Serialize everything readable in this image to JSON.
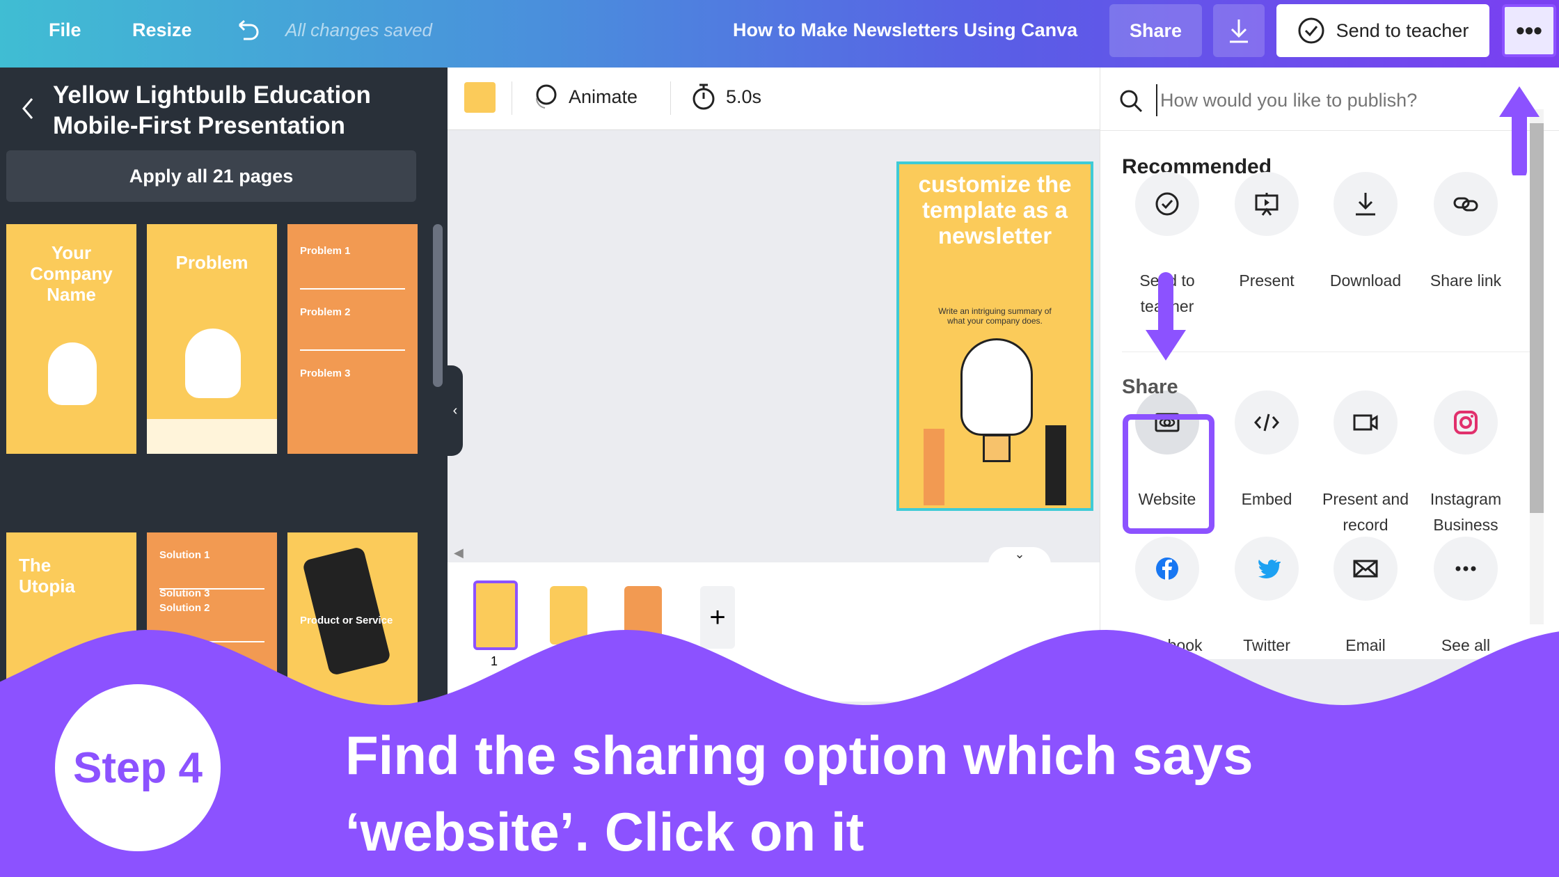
{
  "topbar": {
    "file": "File",
    "resize": "Resize",
    "saved": "All changes saved",
    "title": "How to Make Newsletters Using Canva",
    "share": "Share",
    "send_to_teacher": "Send to teacher"
  },
  "sidebar": {
    "title_line1": "Yellow Lightbulb Education",
    "title_line2": "Mobile-First Presentation",
    "apply": "Apply all 21 pages",
    "thumbs": [
      "Your Company Name",
      "Problem",
      "Problem 1",
      "Problem 2",
      "Problem 3",
      "The Utopia",
      "Solution 1",
      "Solution 2",
      "Solution 3",
      "Product or Service"
    ]
  },
  "toolbar": {
    "color": "#fbcb5a",
    "animate": "Animate",
    "duration": "5.0s"
  },
  "canvas": {
    "heading": "customize the template as a newsletter",
    "summary": "Write an intriguing summary of what your company does.",
    "page_number": "1"
  },
  "panel": {
    "search_placeholder": "How would you like to publish?",
    "recommended": "Recommended",
    "share": "Share",
    "recommended_items": [
      {
        "label": "Send to teacher",
        "icon": "check-circle-icon"
      },
      {
        "label": "Present",
        "icon": "present-icon"
      },
      {
        "label": "Download",
        "icon": "download-icon"
      },
      {
        "label": "Share link",
        "icon": "link-icon"
      }
    ],
    "share_items": [
      {
        "label": "Website",
        "icon": "website-icon"
      },
      {
        "label": "Embed",
        "icon": "embed-icon"
      },
      {
        "label": "Present and record",
        "icon": "video-icon"
      },
      {
        "label": "Instagram Business",
        "icon": "instagram-icon"
      }
    ],
    "more_items": [
      {
        "label": "Facebook",
        "icon": "facebook-icon"
      },
      {
        "label": "Twitter",
        "icon": "twitter-icon"
      },
      {
        "label": "Email",
        "icon": "email-icon"
      },
      {
        "label": "See all",
        "icon": "more-icon"
      }
    ]
  },
  "overlay": {
    "step": "Step 4",
    "line1": "Find the sharing option which says",
    "line2": "‘website’. Click on it",
    "accent": "#8c52ff"
  }
}
